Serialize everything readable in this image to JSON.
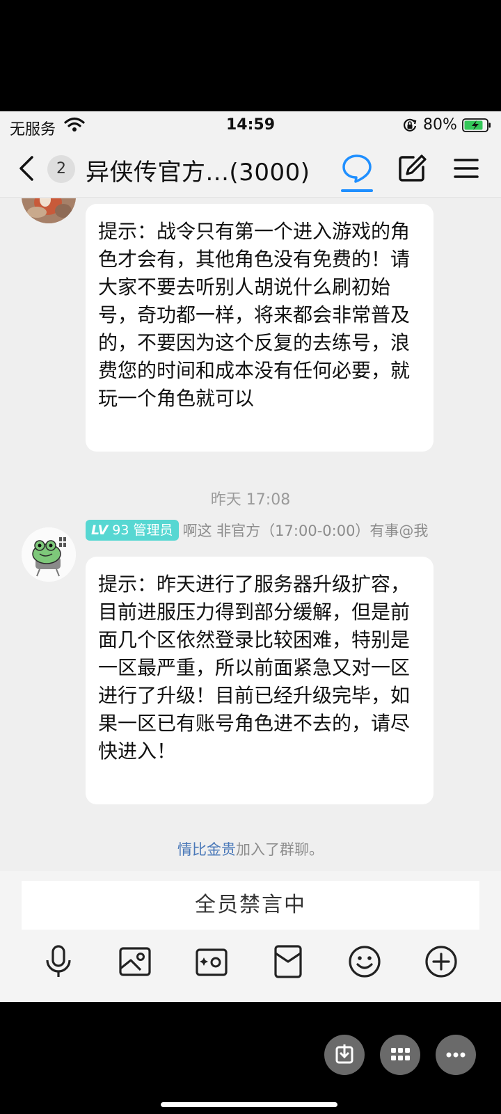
{
  "status_bar": {
    "carrier": "无服务",
    "time": "14:59",
    "battery": "80%"
  },
  "nav": {
    "unread_count": "2",
    "title": "异侠传官方...(3000)"
  },
  "messages": [
    {
      "text": "提示：战令只有第一个进入游戏的角色才会有，其他角色没有免费的！请大家不要去听别人胡说什么刷初始号，奇功都一样，将来都会非常普及的，不要因为这个反复的去练号，浪费您的时间和成本没有任何必要，就玩一个角色就可以"
    },
    {
      "level_prefix": "LV",
      "level": "93",
      "role": "管理员",
      "sender": "啊这 非官方（17:00-0:00）有事@我",
      "text": "提示：昨天进行了服务器升级扩容，目前进服压力得到部分缓解，但是前面几个区依然登录比较困难，特别是一区最严重，所以前面紧急又对一区进行了升级！目前已经升级完毕，如果一区已有账号角色进不去的，请尽快进入！"
    }
  ],
  "time_separator": "昨天 17:08",
  "system_message": {
    "name": "情比金贵",
    "text": "加入了群聊。"
  },
  "input": {
    "muted_label": "全员禁言中"
  },
  "icons": {
    "back": "chevron-left-icon",
    "chat": "chat-bubble-icon",
    "edit": "edit-icon",
    "menu": "menu-icon",
    "mic": "microphone-icon",
    "image": "image-icon",
    "camera": "camera-icon",
    "redpacket": "red-packet-icon",
    "emoji": "emoji-icon",
    "plus": "plus-icon"
  },
  "colors": {
    "accent": "#1f8fff",
    "badge": "#57d7d2",
    "link": "#4a78b8"
  }
}
